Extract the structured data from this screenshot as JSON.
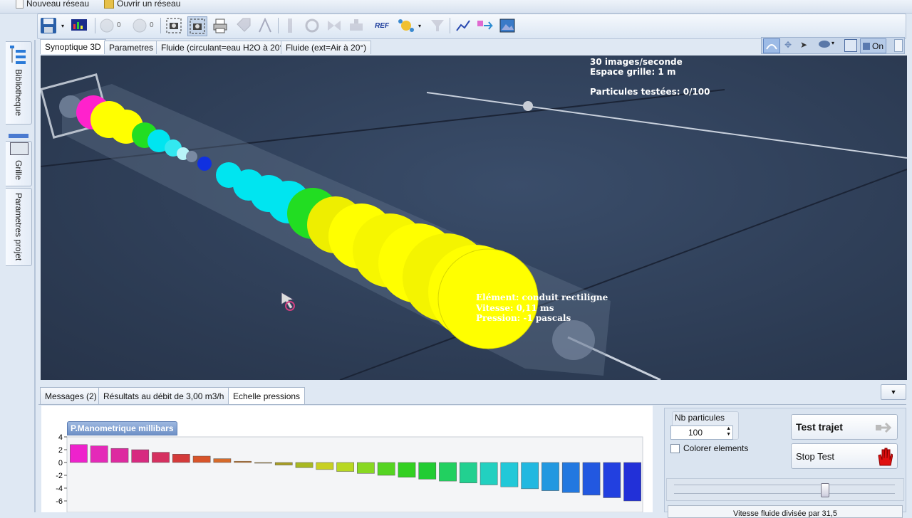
{
  "menu": {
    "new_network": "Nouveau réseau",
    "open_network": "Ouvrir un réseau"
  },
  "toolbar": {
    "counter_a": "0",
    "counter_b": "0",
    "ref_label": "REF"
  },
  "left_tabs": {
    "library": "Bibliotheque",
    "grid": "Grille",
    "project_params": "Parametres projet"
  },
  "main_tabs": [
    {
      "label": "Synoptique 3D"
    },
    {
      "label": "Parametres"
    },
    {
      "label": "Fluide (circulant=eau H2O à 20°)"
    },
    {
      "label": "Fluide (ext=Air à 20°)"
    }
  ],
  "view_tools": {
    "toggle_label": "On"
  },
  "viewport": {
    "fps": "30 images/seconde",
    "grid_spacing": "Espace grille: 1 m",
    "particles_tested": "Particules testées: 0/100",
    "tooltip": {
      "element": "Elément: conduit rectiligne",
      "speed": "Vitesse: 0,11 ms",
      "pressure": "Pression: -1 pascals"
    }
  },
  "bottom_tabs": [
    {
      "label": "Messages (2)"
    },
    {
      "label": "Résultats au débit de 3,00 m3/h"
    },
    {
      "label": "Echelle pressions"
    }
  ],
  "controls": {
    "nb_particles_label": "Nb particules",
    "nb_particles_value": "100",
    "color_elements_label": "Colorer elements",
    "test_path_label": "Test trajet",
    "stop_test_label": "Stop Test",
    "speed_label": "Vitesse fluide divisée par 31,5"
  },
  "colors": {
    "viewport_bg": "#2e3d55",
    "pipe_yellow": "#ffff00",
    "pipe_cyan": "#00e5f0",
    "pipe_green": "#22dd22",
    "pipe_magenta": "#ff22cc",
    "pipe_blue": "#1030e0"
  },
  "chart_data": {
    "type": "bar",
    "title": "P.Manometrique millibars",
    "ylim": [
      -8,
      4
    ],
    "yticks": [
      "4",
      "2",
      "0",
      "-2",
      "-4",
      "-6"
    ],
    "values": [
      2.8,
      2.6,
      2.2,
      2.0,
      1.6,
      1.3,
      1.0,
      0.6,
      0.2,
      -0.1,
      -0.4,
      -0.8,
      -1.1,
      -1.4,
      -1.7,
      -2.0,
      -2.3,
      -2.6,
      -2.9,
      -3.2,
      -3.5,
      -3.8,
      -4.1,
      -4.4,
      -4.7,
      -5.1,
      -5.5,
      -6.0
    ],
    "colors": [
      "#ee22cc",
      "#e42ab8",
      "#dd2aa0",
      "#d72a80",
      "#d53060",
      "#d43a3a",
      "#d8542a",
      "#d66a2a",
      "#cc7a2a",
      "#b88a28",
      "#a89e22",
      "#a8b822",
      "#c8d022",
      "#b8d822",
      "#88d822",
      "#55d422",
      "#33d022",
      "#22cc33",
      "#22d060",
      "#22d090",
      "#22d0c0",
      "#22c8d8",
      "#22b8e0",
      "#2298e0",
      "#2278e0",
      "#2258e0",
      "#2240e0",
      "#2230d8"
    ]
  }
}
